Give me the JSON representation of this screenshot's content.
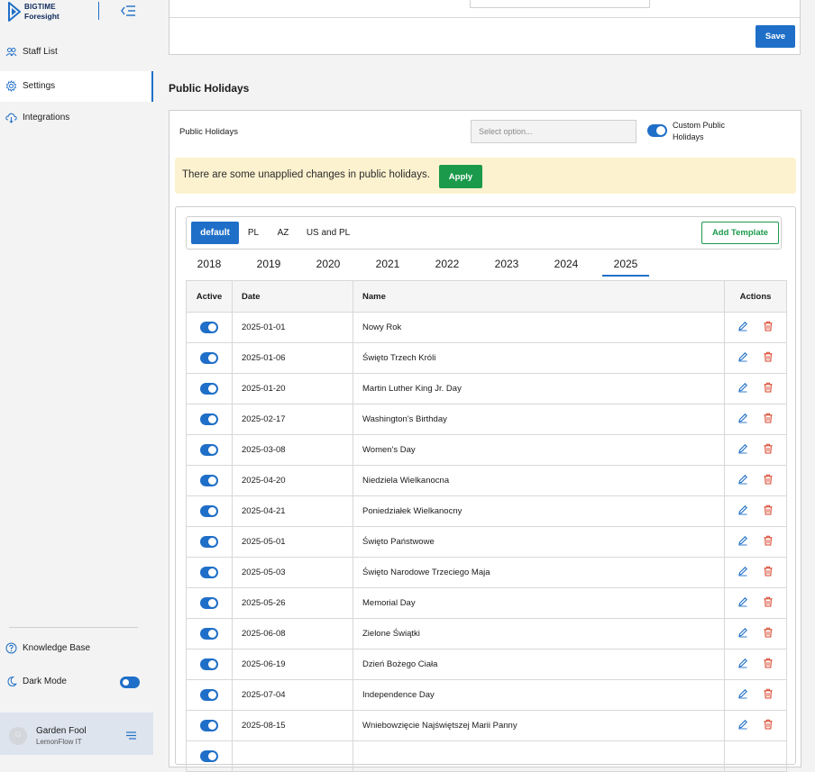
{
  "brand": {
    "line1": "BIGTIME",
    "line2": "Foresight"
  },
  "sidebar": {
    "items": [
      {
        "label": "Staff List",
        "icon": "users-icon"
      },
      {
        "label": "Settings",
        "icon": "gear-icon"
      },
      {
        "label": "Integrations",
        "icon": "cloud-icon"
      }
    ],
    "bottom": [
      {
        "label": "Knowledge Base",
        "icon": "help-icon"
      },
      {
        "label": "Dark Mode",
        "icon": "moon-icon"
      }
    ],
    "user": {
      "name": "Garden Fool",
      "org": "LemonFlow IT"
    }
  },
  "top_panel": {
    "save_label": "Save"
  },
  "public_holidays": {
    "title": "Public Holidays",
    "field_label": "Public Holidays",
    "select_placeholder": "Select option...",
    "custom_label": "Custom Public Holidays",
    "warning_text": "There are some unapplied changes in public holidays.",
    "apply_label": "Apply",
    "add_template_label": "Add Template",
    "templates": [
      "default",
      "PL",
      "AZ",
      "US and PL"
    ],
    "years": [
      "2018",
      "2019",
      "2020",
      "2021",
      "2022",
      "2023",
      "2024",
      "2025"
    ],
    "active_year": "2025",
    "columns": [
      "Active",
      "Date",
      "Name",
      "Actions"
    ],
    "rows": [
      {
        "date": "2025-01-01",
        "name": "Nowy Rok"
      },
      {
        "date": "2025-01-06",
        "name": "Święto Trzech Króli"
      },
      {
        "date": "2025-01-20",
        "name": "Martin Luther King Jr. Day"
      },
      {
        "date": "2025-02-17",
        "name": "Washington's Birthday"
      },
      {
        "date": "2025-03-08",
        "name": "Women's Day"
      },
      {
        "date": "2025-04-20",
        "name": "Niedziela Wielkanocna"
      },
      {
        "date": "2025-04-21",
        "name": "Poniedziałek Wielkanocny"
      },
      {
        "date": "2025-05-01",
        "name": "Święto Państwowe"
      },
      {
        "date": "2025-05-03",
        "name": "Święto Narodowe Trzeciego Maja"
      },
      {
        "date": "2025-05-26",
        "name": "Memorial Day"
      },
      {
        "date": "2025-06-08",
        "name": "Zielone Świątki"
      },
      {
        "date": "2025-06-19",
        "name": "Dzień Bożego Ciała"
      },
      {
        "date": "2025-07-04",
        "name": "Independence Day"
      },
      {
        "date": "2025-08-15",
        "name": "Wniebowzięcie Najświętszej Marii Panny"
      }
    ]
  },
  "colors": {
    "primary": "#1f6fc8",
    "success": "#1b9a4b",
    "danger": "#d9452c",
    "warning_bg": "#fdf2cf"
  }
}
